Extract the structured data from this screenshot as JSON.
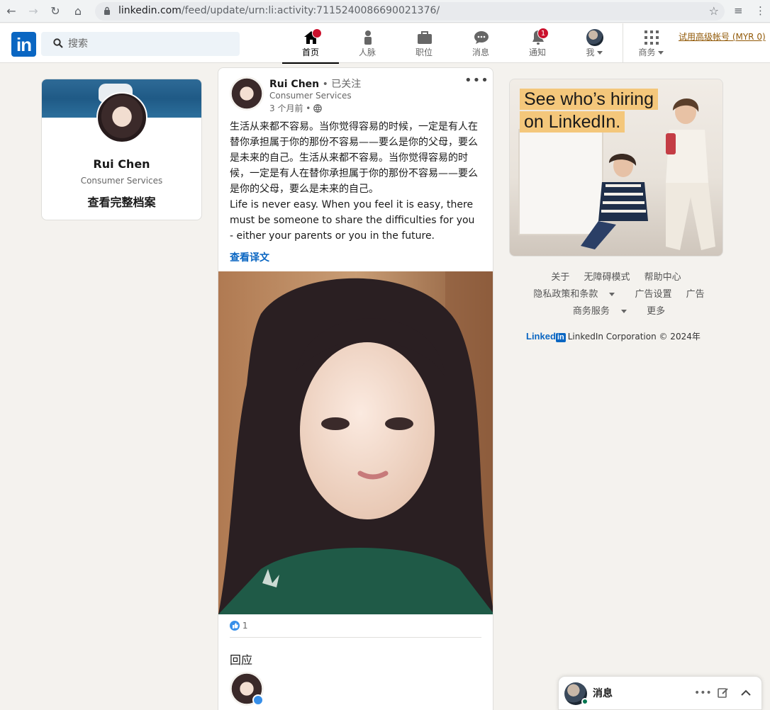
{
  "browser": {
    "url_host": "linkedin.com",
    "url_path": "/feed/update/urn:li:activity:7115240086690021376/"
  },
  "nav": {
    "search_placeholder": "搜索",
    "items": [
      {
        "label": "首页",
        "badge": ""
      },
      {
        "label": "人脉",
        "badge": ""
      },
      {
        "label": "职位",
        "badge": ""
      },
      {
        "label": "消息",
        "badge": ""
      },
      {
        "label": "通知",
        "badge": "1"
      },
      {
        "label": "我",
        "badge": ""
      },
      {
        "label": "商务",
        "badge": ""
      }
    ],
    "premium_link": "试用高级帐号 (MYR 0)"
  },
  "profile": {
    "name": "Rui Chen",
    "headline": "Consumer Services",
    "view_profile": "查看完整档案"
  },
  "post": {
    "author": "Rui Chen",
    "follow_status": "• 已关注",
    "author_headline": "Consumer Services",
    "time": "3 个月前 •",
    "text_zh": "生活从来都不容易。当你觉得容易的时候，一定是有人在替你承担属于你的那份不容易——要么是你的父母，要么是未来的自己。生活从来都不容易。当你觉得容易的时候，一定是有人在替你承担属于你的那份不容易——要么是你的父母，要么是未来的自己。",
    "text_en": "Life is never easy. When you feel it is easy, there must be someone to share the difficulties for you - either your parents or you in the future.",
    "translate_link": "查看译文",
    "reaction_count": "1",
    "comments_heading": "回应"
  },
  "ad": {
    "line1": "See who’s hiring",
    "line2": "on LinkedIn."
  },
  "footer": {
    "row1": [
      "关于",
      "无障碍模式",
      "帮助中心"
    ],
    "row2": [
      "隐私政策和条款",
      "广告设置",
      "广告"
    ],
    "row3": [
      "商务服务",
      "更多"
    ],
    "brand_word": "Linked",
    "brand_in": "in",
    "copyright": "LinkedIn Corporation © 2024年"
  },
  "messaging": {
    "title": "消息"
  },
  "colors": {
    "brand": "#0a66c2",
    "notification": "#cb112d",
    "premium": "#915907",
    "online": "#01754f"
  }
}
